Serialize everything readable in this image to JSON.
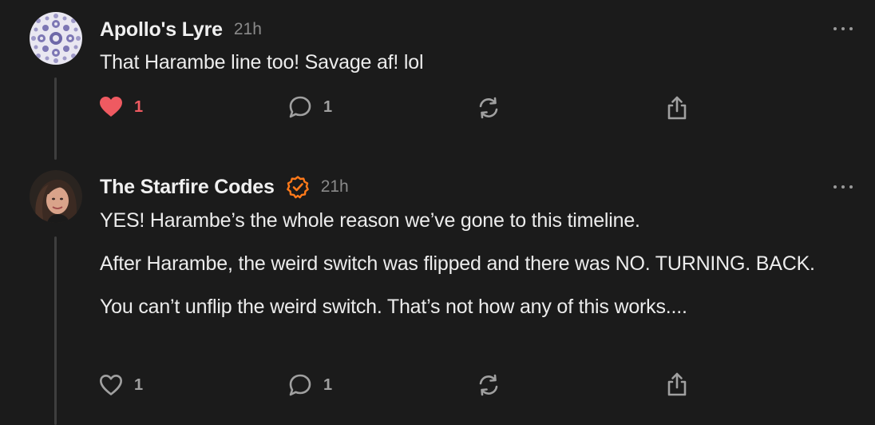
{
  "colors": {
    "background": "#1b1b1b",
    "like_active": "#ef5a61",
    "verified": "#ff7a1a",
    "muted": "#8a8a8a"
  },
  "comments": [
    {
      "author": "Apollo's Lyre",
      "time": "21h",
      "verified": false,
      "avatar_icon": "mandala-avatar",
      "paragraphs": [
        "That Harambe line too! Savage af! lol"
      ],
      "likes": "1",
      "liked": true,
      "replies": "1"
    },
    {
      "author": "The Starfire Codes",
      "time": "21h",
      "verified": true,
      "avatar_icon": "profile-photo-avatar",
      "paragraphs": [
        "YES! Harambe’s the whole reason we’ve gone to this timeline.",
        "After Harambe, the weird switch was flipped and there was NO. TURNING. BACK.",
        "You can’t unflip the weird switch. That’s not how any of this works...."
      ],
      "likes": "1",
      "liked": false,
      "replies": "1"
    }
  ]
}
